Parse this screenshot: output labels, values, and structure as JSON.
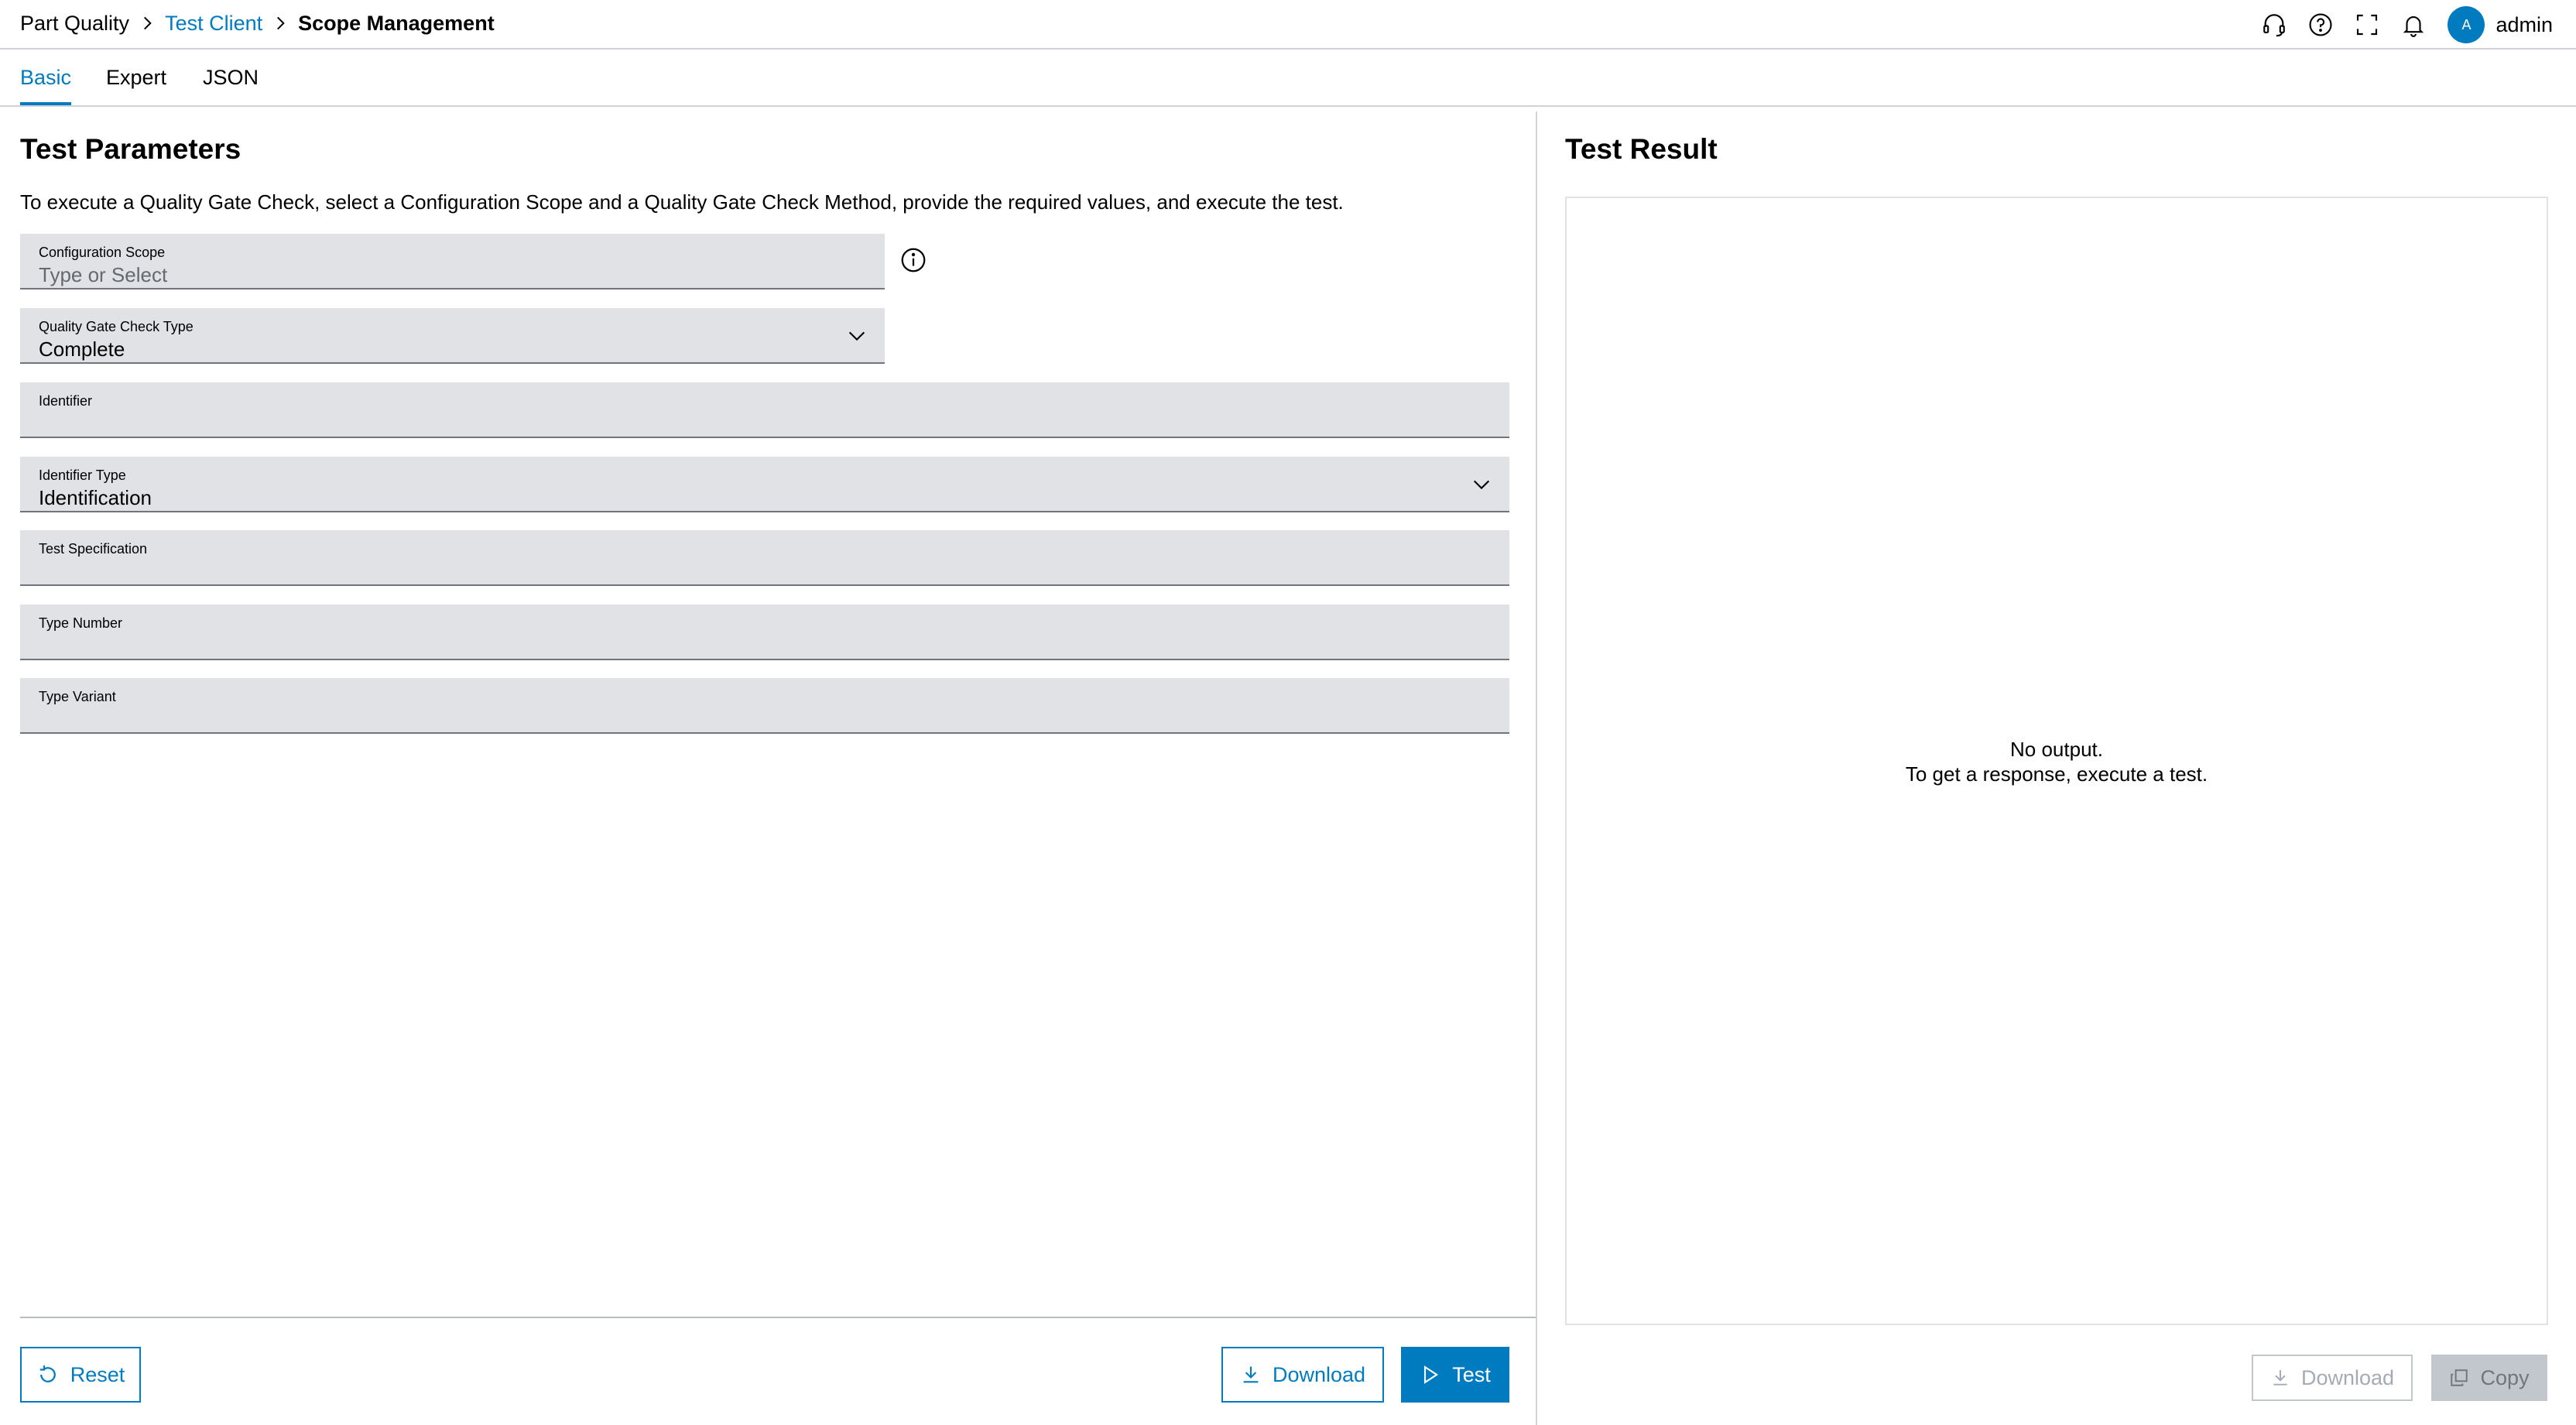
{
  "breadcrumb": {
    "items": [
      "Part Quality",
      "Test Client",
      "Scope Management"
    ]
  },
  "header": {
    "icons": [
      "headset-icon",
      "help-icon",
      "fullscreen-icon",
      "bell-icon"
    ],
    "user": {
      "initial": "A",
      "name": "admin"
    }
  },
  "tabs": [
    {
      "label": "Basic",
      "active": true
    },
    {
      "label": "Expert",
      "active": false
    },
    {
      "label": "JSON",
      "active": false
    }
  ],
  "parameters": {
    "title": "Test Parameters",
    "description": "To execute a Quality Gate Check, select a Configuration Scope and a Quality Gate Check Method, provide the required values, and execute the test.",
    "fields": {
      "configuration_scope": {
        "label": "Configuration Scope",
        "placeholder": "Type or Select",
        "value": ""
      },
      "quality_gate_check_type": {
        "label": "Quality Gate Check Type",
        "value": "Complete"
      },
      "identifier": {
        "label": "Identifier",
        "value": ""
      },
      "identifier_type": {
        "label": "Identifier Type",
        "value": "Identification"
      },
      "test_specification": {
        "label": "Test Specification",
        "value": ""
      },
      "type_number": {
        "label": "Type Number",
        "value": ""
      },
      "type_variant": {
        "label": "Type Variant",
        "value": ""
      }
    },
    "buttons": {
      "reset": "Reset",
      "download": "Download",
      "test": "Test"
    }
  },
  "result": {
    "title": "Test Result",
    "empty_line1": "No output.",
    "empty_line2": "To get a response, execute a test.",
    "buttons": {
      "download": "Download",
      "copy": "Copy"
    }
  },
  "colors": {
    "accent": "#007bc0",
    "field_background": "#e0e2e5",
    "divider": "#d0d4d8",
    "disabled": "#c1c7cc"
  }
}
